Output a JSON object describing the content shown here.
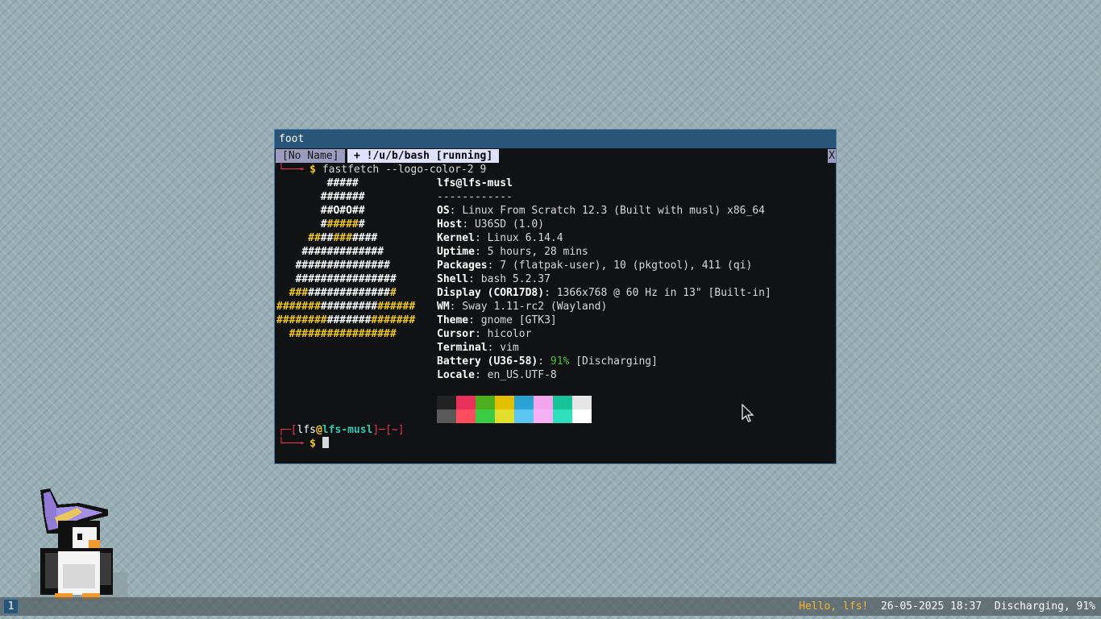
{
  "window": {
    "title": "foot"
  },
  "tabs": {
    "inactive": "[No Name]",
    "active": "+ !/u/b/bash [running]",
    "close": "X"
  },
  "command": {
    "corner": "└──╼",
    "prompt": "$",
    "text": "fastfetch --logo-color-2 9"
  },
  "logo": [
    [
      [
        "w",
        "#####"
      ]
    ],
    [
      [
        "w",
        "#######"
      ]
    ],
    [
      [
        "w",
        "##O#O##"
      ]
    ],
    [
      [
        "w",
        "#"
      ],
      [
        "y",
        "#####"
      ],
      [
        "w",
        "#"
      ]
    ],
    [
      [
        "y",
        "##"
      ],
      [
        "w",
        "##"
      ],
      [
        "y",
        "###"
      ],
      [
        "w",
        "####"
      ]
    ],
    [
      [
        "w",
        "#############"
      ]
    ],
    [
      [
        "w",
        "###############"
      ]
    ],
    [
      [
        "w",
        "################"
      ]
    ],
    [
      [
        "y",
        "###"
      ],
      [
        "w",
        "#############"
      ],
      [
        "y",
        "#"
      ]
    ],
    [
      [
        "y",
        "#######"
      ],
      [
        "w",
        "#########"
      ],
      [
        "y",
        "######"
      ]
    ],
    [
      [
        "y",
        "########"
      ],
      [
        "w",
        "#######"
      ],
      [
        "y",
        "#######"
      ]
    ],
    [
      [
        "y",
        "#################"
      ]
    ]
  ],
  "logo_indent": [
    8,
    7,
    7,
    7,
    5,
    4,
    3,
    3,
    2,
    0,
    0,
    2
  ],
  "info": {
    "user_host": "lfs@lfs-musl",
    "separator": "------------",
    "rows": [
      {
        "key": "OS",
        "value": "Linux From Scratch 12.3 (Built with musl) x86_64"
      },
      {
        "key": "Host",
        "value": "U36SD (1.0)"
      },
      {
        "key": "Kernel",
        "value": "Linux 6.14.4"
      },
      {
        "key": "Uptime",
        "value": "5 hours, 28 mins"
      },
      {
        "key": "Packages",
        "value": "7 (flatpak-user), 10 (pkgtool), 411 (qi)"
      },
      {
        "key": "Shell",
        "value": "bash 5.2.37"
      },
      {
        "key": "Display (COR17D8)",
        "value": "1366x768 @ 60 Hz in 13\" [Built-in]"
      },
      {
        "key": "WM",
        "value": "Sway 1.11-rc2 (Wayland)"
      },
      {
        "key": "Theme",
        "value": "gnome [GTK3]"
      },
      {
        "key": "Cursor",
        "value": "hicolor"
      },
      {
        "key": "Terminal",
        "value": "vim"
      }
    ],
    "battery": {
      "key": "Battery (U36-58)",
      "percent": "91%",
      "state": "[Discharging]"
    },
    "locale": {
      "key": "Locale",
      "value": "en_US.UTF-8"
    },
    "key_sep": ": "
  },
  "palette": {
    "normal": [
      "#222222",
      "#e8305a",
      "#4caf1b",
      "#e2c000",
      "#2aa2d4",
      "#f3a6ee",
      "#19c39a",
      "#e6e6e6"
    ],
    "bright": [
      "#595959",
      "#ff4d5e",
      "#3ccc44",
      "#e3de2c",
      "#5cc6f2",
      "#f7b0f3",
      "#2ee0bc",
      "#ffffff"
    ]
  },
  "prompt2": {
    "open_corner": "┌─[",
    "user": "lfs",
    "at": "@",
    "host": "lfs-musl",
    "mid": "]─[",
    "dir": "~",
    "close": "]",
    "corner": "└──╼",
    "dollar": "$"
  },
  "bar": {
    "workspace": "1",
    "greeting": "Hello, lfs!",
    "datetime": "26-05-2025 18:37",
    "battery": "Discharging, 91%"
  }
}
